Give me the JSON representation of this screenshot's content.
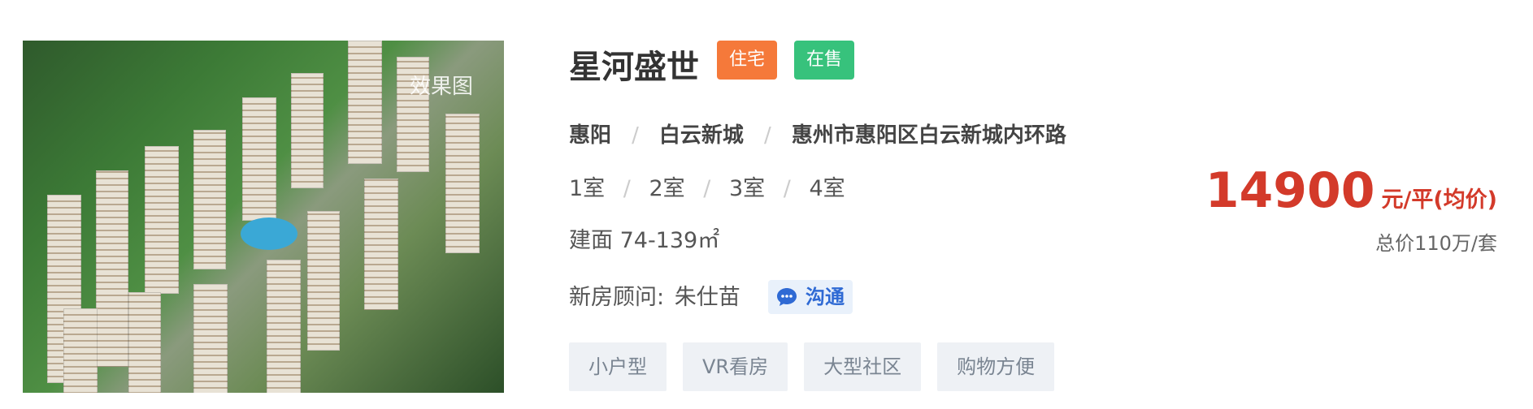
{
  "listing": {
    "image_tag": "效果图",
    "title": "星河盛世",
    "badges": {
      "property_type": "住宅",
      "status": "在售"
    },
    "location": {
      "city": "惠阳",
      "district": "白云新城",
      "address": "惠州市惠阳区白云新城内环路"
    },
    "rooms": [
      "1室",
      "2室",
      "3室",
      "4室"
    ],
    "area": "建面 74-139㎡",
    "consultant": {
      "label": "新房顾问:",
      "name": "朱仕苗",
      "chat_label": "沟通"
    },
    "tags": [
      "小户型",
      "VR看房",
      "大型社区",
      "购物方便"
    ],
    "price": {
      "value": "14900",
      "unit": "元/平(均价)",
      "total": "总价110万/套"
    }
  },
  "colors": {
    "price": "#d33a2a",
    "badge_residential": "#f5793a",
    "badge_on_sale": "#37c27c",
    "chat_text": "#2f6ad4"
  },
  "icons": {
    "chat": "chat-bubble-icon"
  }
}
